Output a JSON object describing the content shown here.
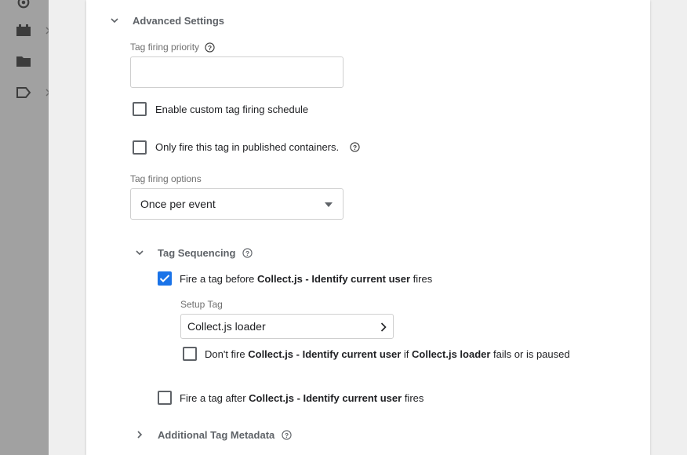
{
  "nav_rail": {
    "icons": [
      "target-icon",
      "puzzle-icon",
      "folder-icon",
      "tag-icon"
    ]
  },
  "advanced_settings": {
    "title": "Advanced Settings",
    "priority_label": "Tag firing priority",
    "priority_value": "",
    "custom_schedule_label": "Enable custom tag firing schedule",
    "custom_schedule_checked": false,
    "published_only_label": "Only fire this tag in published containers.",
    "published_only_checked": false,
    "firing_options_label": "Tag firing options",
    "firing_options_value": "Once per event"
  },
  "tag_sequencing": {
    "title": "Tag Sequencing",
    "before": {
      "prefix": "Fire a tag before ",
      "tag_name": "Collect.js - Identify current user",
      "suffix": " fires",
      "checked": true
    },
    "setup_tag_label": "Setup Tag",
    "setup_tag_value": "Collect.js loader",
    "dont_fire": {
      "prefix": "Don't fire ",
      "tag_name": "Collect.js - Identify current user",
      "middle": " if ",
      "setup_name": "Collect.js loader",
      "suffix": " fails or is paused",
      "checked": false
    },
    "after": {
      "prefix": "Fire a tag after ",
      "tag_name": "Collect.js - Identify current user",
      "suffix": " fires",
      "checked": false
    }
  },
  "additional_metadata": {
    "title": "Additional Tag Metadata"
  },
  "colors": {
    "accent": "#1a73e8",
    "rail": "#a1a1a1",
    "panel": "#ffffff"
  }
}
